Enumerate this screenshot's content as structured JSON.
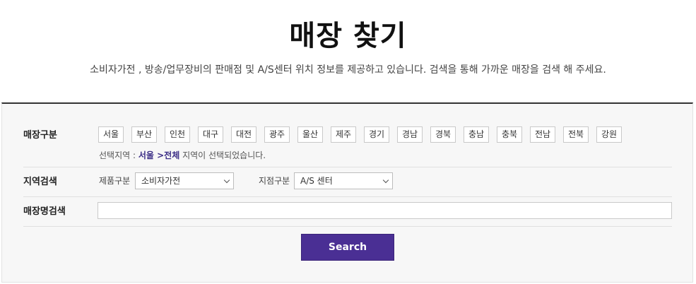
{
  "page": {
    "title": "매장 찾기",
    "description": "소비자가전 , 방송/업무장비의 판매점 및 A/S센터 위치 정보를 제공하고 있습니다. 검색을 통해 가까운 매장을 검색 해 주세요."
  },
  "store_type": {
    "label": "매장구분",
    "regions": [
      "서울",
      "부산",
      "인천",
      "대구",
      "대전",
      "광주",
      "울산",
      "제주",
      "경기",
      "경남",
      "경북",
      "충남",
      "충북",
      "전남",
      "전북",
      "강원"
    ],
    "selection_prefix": "선택지역 : ",
    "selected_region": "서울",
    "selected_sub": " >전체",
    "selection_suffix": " 지역이 선택되었습니다."
  },
  "region_search": {
    "label": "지역검색",
    "product_label": "제품구분",
    "product_value": "소비자가전",
    "branch_label": "지점구분",
    "branch_value": "A/S 센터"
  },
  "store_name_search": {
    "label": "매장명검색",
    "value": ""
  },
  "search_button": {
    "label": "Search"
  },
  "colors": {
    "accent": "#4a2f94",
    "highlight_text": "#3b2d86"
  }
}
